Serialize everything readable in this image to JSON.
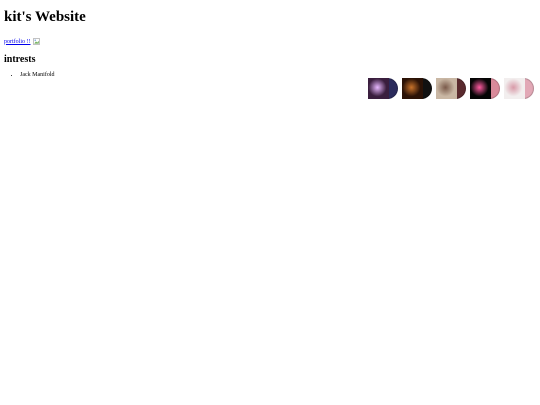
{
  "page": {
    "title": "kit's Website",
    "link_label": "portfolio !!",
    "section_heading": "intrests",
    "list_items": [
      "Jack Manifold"
    ]
  },
  "records": [
    {
      "icon": "album-cover-icon",
      "sleeve": "#3a1e3e",
      "sleeve_accent": "#e8b8ff",
      "disc": "#2a2a5c"
    },
    {
      "icon": "album-cover-icon",
      "sleeve": "#2b1206",
      "sleeve_accent": "#c8722a",
      "disc": "#111111"
    },
    {
      "icon": "album-cover-icon",
      "sleeve": "#c9b7a4",
      "sleeve_accent": "#7a5a4a",
      "disc": "#5a2a2e"
    },
    {
      "icon": "album-cover-icon",
      "sleeve": "#050505",
      "sleeve_accent": "#ff5aa0",
      "disc": "#d98a9a"
    },
    {
      "icon": "album-cover-icon",
      "sleeve": "#f2eeee",
      "sleeve_accent": "#d89aa8",
      "disc": "#e2a8b6"
    }
  ]
}
